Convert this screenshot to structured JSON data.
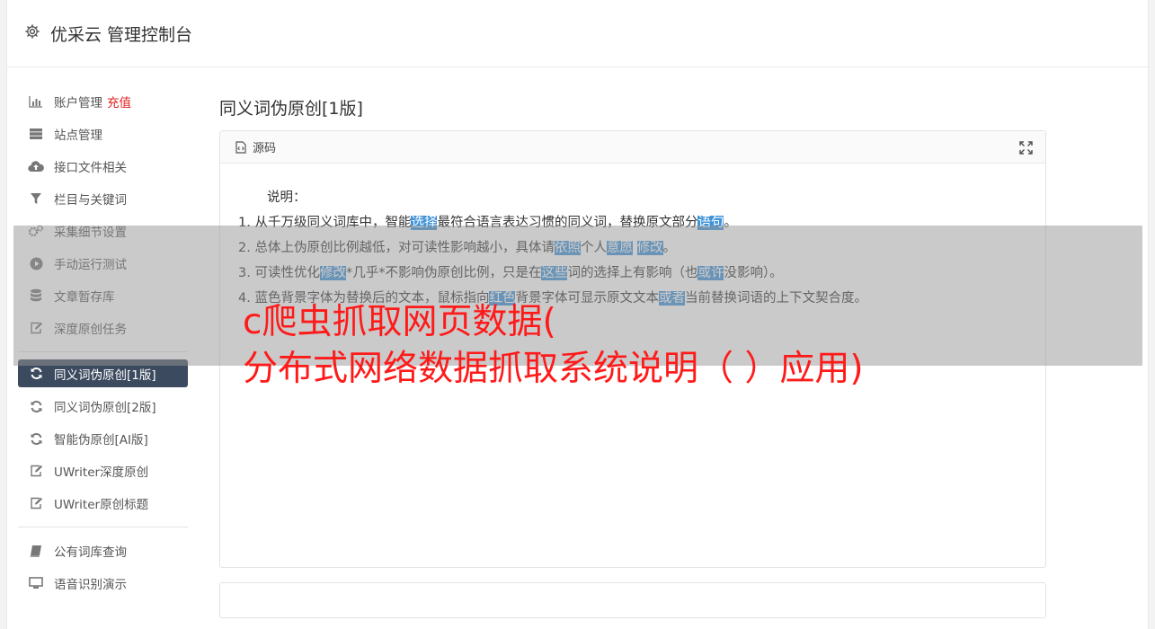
{
  "app": {
    "title": "优采云 管理控制台",
    "icon": "gear-icon"
  },
  "sidebar": {
    "group1": [
      {
        "label": "账户管理",
        "badge": "充值",
        "icon": "bar-chart-icon"
      },
      {
        "label": "站点管理",
        "icon": "server-icon"
      },
      {
        "label": "接口文件相关",
        "icon": "cloud-upload-icon"
      },
      {
        "label": "栏目与关键词",
        "icon": "filter-icon"
      },
      {
        "label": "采集细节设置",
        "icon": "cogs-icon"
      },
      {
        "label": "手动运行测试",
        "icon": "play-circle-icon"
      },
      {
        "label": "文章暂存库",
        "icon": "database-icon"
      },
      {
        "label": "深度原创任务",
        "icon": "edit-icon"
      }
    ],
    "group2": [
      {
        "label": "同义词伪原创[1版]",
        "icon": "refresh-icon",
        "active": true
      },
      {
        "label": "同义词伪原创[2版]",
        "icon": "refresh-icon"
      },
      {
        "label": "智能伪原创[AI版]",
        "icon": "refresh-icon"
      },
      {
        "label": "UWriter深度原创",
        "icon": "edit-icon"
      },
      {
        "label": "UWriter原创标题",
        "icon": "edit-icon"
      }
    ],
    "group3": [
      {
        "label": "公有词库查询",
        "icon": "book-icon"
      },
      {
        "label": "语音识别演示",
        "icon": "desktop-icon"
      }
    ]
  },
  "main": {
    "title": "同义词伪原创[1版]",
    "panel": {
      "header": "源码",
      "desc_title": "说明：",
      "lines": [
        [
          {
            "t": "1. 从千万级同义词库中，智能"
          },
          {
            "t": "选择",
            "hl": true
          },
          {
            "t": "最符合语言表达习惯的同义词，替换原文部分"
          },
          {
            "t": "语句",
            "hl": true
          },
          {
            "t": "。"
          }
        ],
        [
          {
            "t": "2. 总体上伪原创比例越低，对可读性影响越小，具体请"
          },
          {
            "t": "依照",
            "hl": true
          },
          {
            "t": "个人"
          },
          {
            "t": "意愿",
            "hl": true
          },
          {
            "t": " "
          },
          {
            "t": "修改",
            "hl": true
          },
          {
            "t": "。"
          }
        ],
        [
          {
            "t": "3. 可读性优化"
          },
          {
            "t": "修改",
            "hl": true
          },
          {
            "t": "*几乎*不影响伪原创比例，只是在"
          },
          {
            "t": "这些",
            "hl": true
          },
          {
            "t": "词的选择上有影响（也"
          },
          {
            "t": "或许",
            "hl": true
          },
          {
            "t": "没影响）。"
          }
        ],
        [
          {
            "t": "4. 蓝色背景字体为替换后的文本，鼠标指向"
          },
          {
            "t": "红色",
            "hl": true
          },
          {
            "t": "背景字体可显示原文文本"
          },
          {
            "t": "或者",
            "hl": true
          },
          {
            "t": "当前替换词语的上下文契合度。"
          }
        ]
      ]
    }
  },
  "overlay": {
    "line1": "c爬虫抓取网页数据(",
    "line2": "分布式网络数据抓取系统说明（ ）应用)"
  },
  "colors": {
    "active_nav": "#3c4a5f",
    "highlight": "#3f93d9",
    "overlay_text": "#ff1a1a",
    "badge": "#e02020"
  }
}
